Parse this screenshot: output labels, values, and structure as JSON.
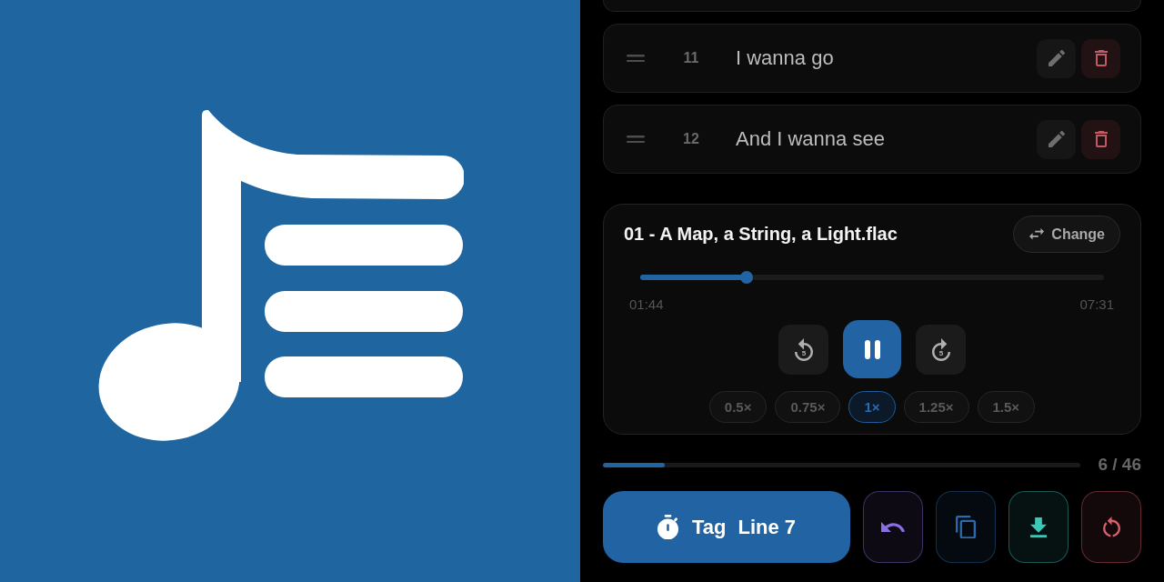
{
  "lyric_lines": [
    {
      "number": "11",
      "text": "I wanna go"
    },
    {
      "number": "12",
      "text": "And I wanna see"
    }
  ],
  "player": {
    "file_name": "01 - A Map, a String, a Light.flac",
    "change_button": "Change",
    "seek": {
      "level": 0.23
    },
    "elapsed": "01:44",
    "duration": "07:31",
    "skip_back_label": "5",
    "skip_forward_label": "5",
    "playing": true,
    "speeds": [
      {
        "label": "0.5×",
        "selected": false
      },
      {
        "label": "0.75×",
        "selected": false
      },
      {
        "label": "1×",
        "selected": true
      },
      {
        "label": "1.25×",
        "selected": false
      },
      {
        "label": "1.5×",
        "selected": false
      }
    ]
  },
  "progress": {
    "level": 0.13,
    "count": "6 / 46"
  },
  "tag_button": {
    "label": "Tag",
    "line": "Line 7"
  },
  "actions": [
    {
      "kind": "undo",
      "color": "#8b6fe0"
    },
    {
      "kind": "copy",
      "color": "#2a6bb0"
    },
    {
      "kind": "download",
      "color": "#3cc8b8"
    },
    {
      "kind": "reset",
      "color": "#d9606c"
    }
  ]
}
